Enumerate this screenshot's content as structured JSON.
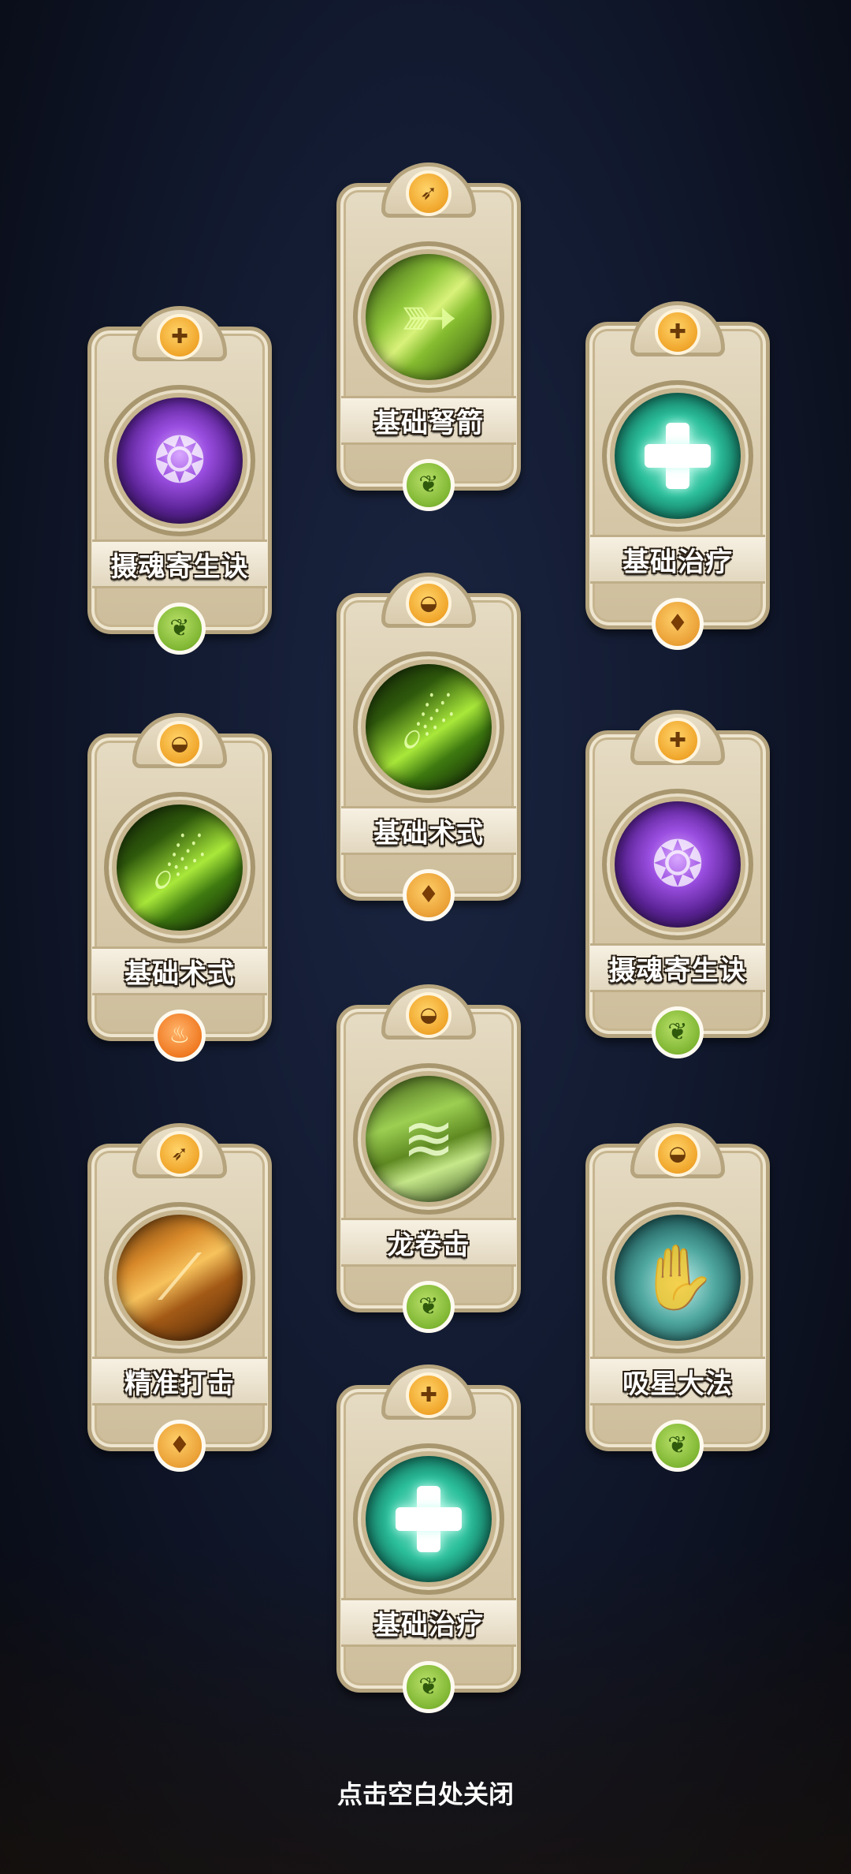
{
  "cards": [
    {
      "id": "c1",
      "name": "基础弩箭",
      "type_icon": "crossbow-icon",
      "type_glyph": "➶",
      "portrait": "arrow",
      "element": "leaf"
    },
    {
      "id": "c2",
      "name": "摄魂寄生诀",
      "type_icon": "heart-plus-icon",
      "type_glyph": "✚",
      "portrait": "soul",
      "element": "leaf"
    },
    {
      "id": "c3",
      "name": "基础治疗",
      "type_icon": "heart-plus-icon",
      "type_glyph": "✚",
      "portrait": "heal",
      "element": "earth"
    },
    {
      "id": "c4",
      "name": "基础术式",
      "type_icon": "mortar-icon",
      "type_glyph": "◒",
      "portrait": "spell",
      "element": "earth"
    },
    {
      "id": "c5",
      "name": "基础术式",
      "type_icon": "mortar-icon",
      "type_glyph": "◒",
      "portrait": "spell",
      "element": "fire"
    },
    {
      "id": "c6",
      "name": "摄魂寄生诀",
      "type_icon": "heart-plus-icon",
      "type_glyph": "✚",
      "portrait": "soul",
      "element": "leaf"
    },
    {
      "id": "c7",
      "name": "龙卷击",
      "type_icon": "mortar-icon",
      "type_glyph": "◒",
      "portrait": "tornado",
      "element": "leaf"
    },
    {
      "id": "c8",
      "name": "精准打击",
      "type_icon": "crossbow-icon",
      "type_glyph": "➶",
      "portrait": "strike",
      "element": "earth"
    },
    {
      "id": "c9",
      "name": "吸星大法",
      "type_icon": "mortar-icon",
      "type_glyph": "◒",
      "portrait": "absorb",
      "element": "leaf"
    },
    {
      "id": "c10",
      "name": "基础治疗",
      "type_icon": "heart-plus-icon",
      "type_glyph": "✚",
      "portrait": "heal",
      "element": "leaf"
    }
  ],
  "element_glyphs": {
    "leaf": "❦",
    "earth": "♦",
    "fire": "♨"
  },
  "close_hint": "点击空白处关闭"
}
